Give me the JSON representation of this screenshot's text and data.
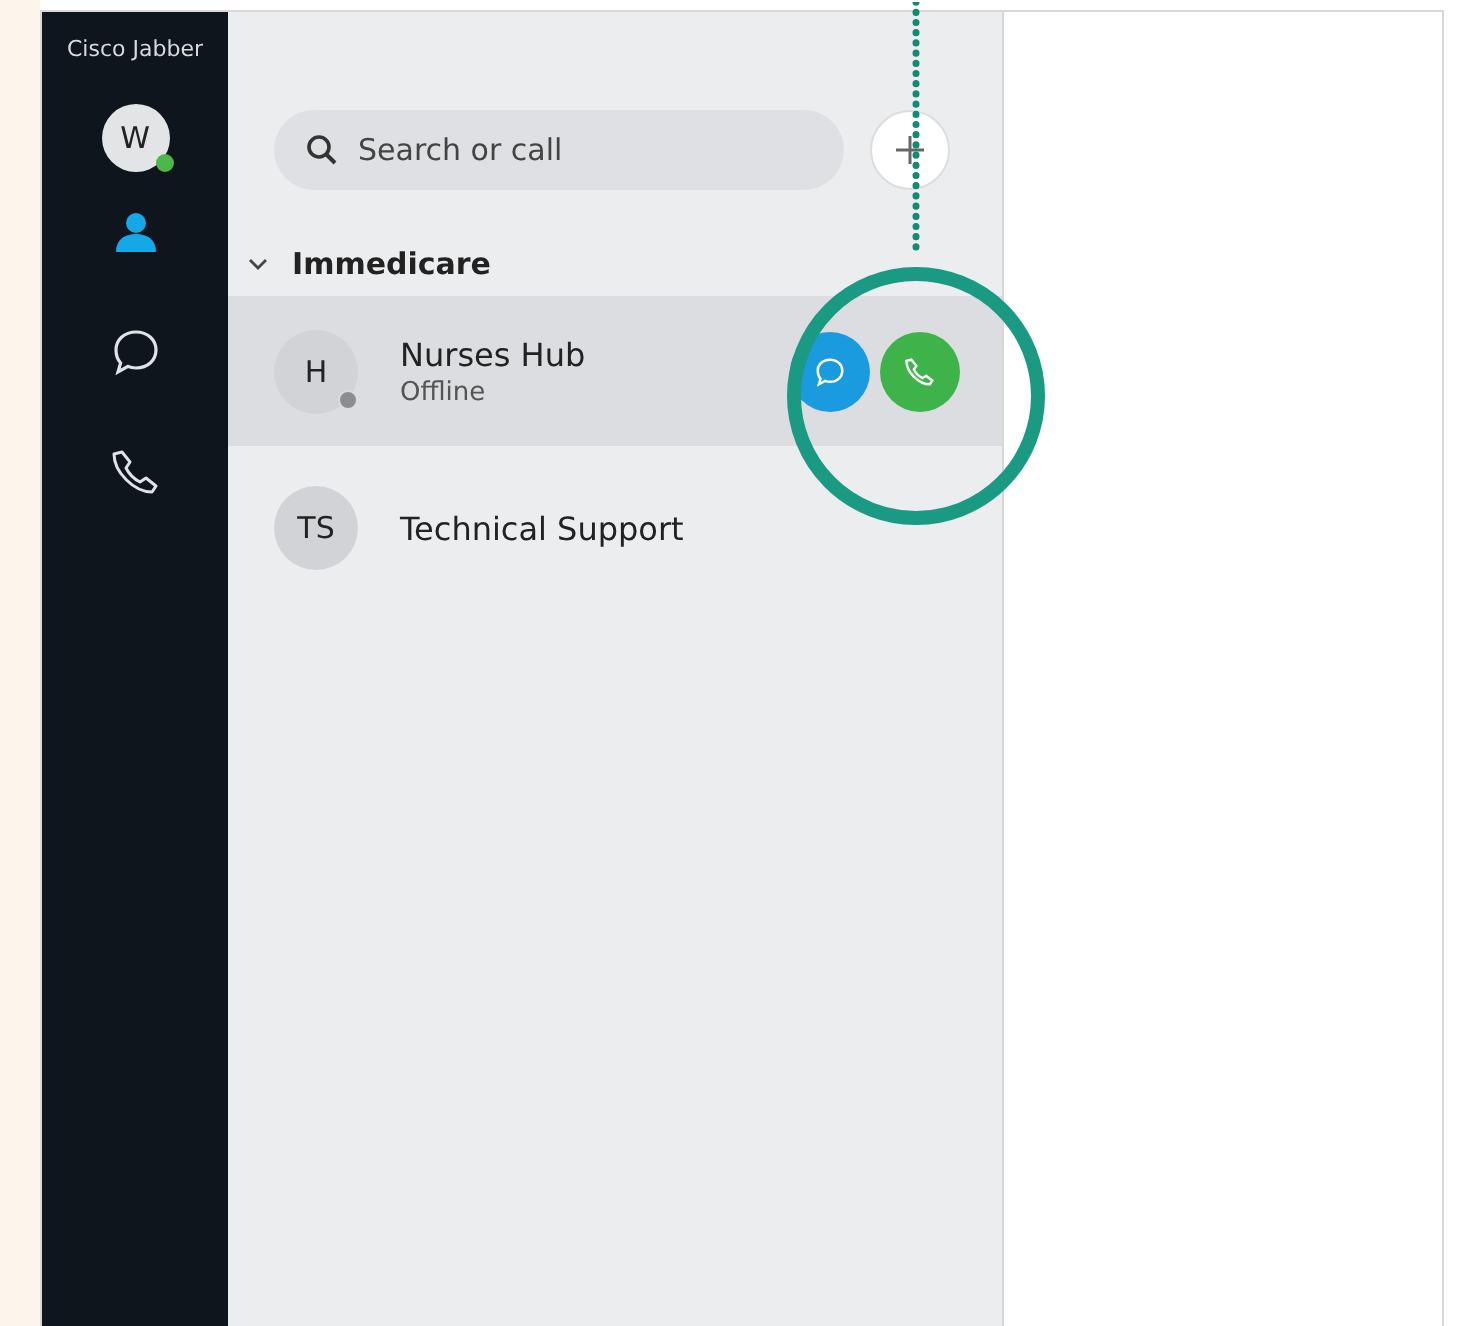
{
  "app": {
    "title": "Cisco Jabber"
  },
  "user": {
    "initials": "W",
    "color": "#4cb848"
  },
  "nav": [
    {
      "kind": "contacts",
      "selected": true
    },
    {
      "kind": "chat",
      "selected": false
    },
    {
      "kind": "phone",
      "selected": false
    }
  ],
  "search": {
    "placeholder": "Search or call"
  },
  "group": {
    "name": "Immedicare",
    "expanded": true,
    "contacts": [
      {
        "initials": "H",
        "name": "Nurses Hub",
        "status": "Offline",
        "color": "#8a8d91",
        "selected": true
      },
      {
        "initials": "TS",
        "name": "Technical Support",
        "selected": false
      }
    ]
  }
}
